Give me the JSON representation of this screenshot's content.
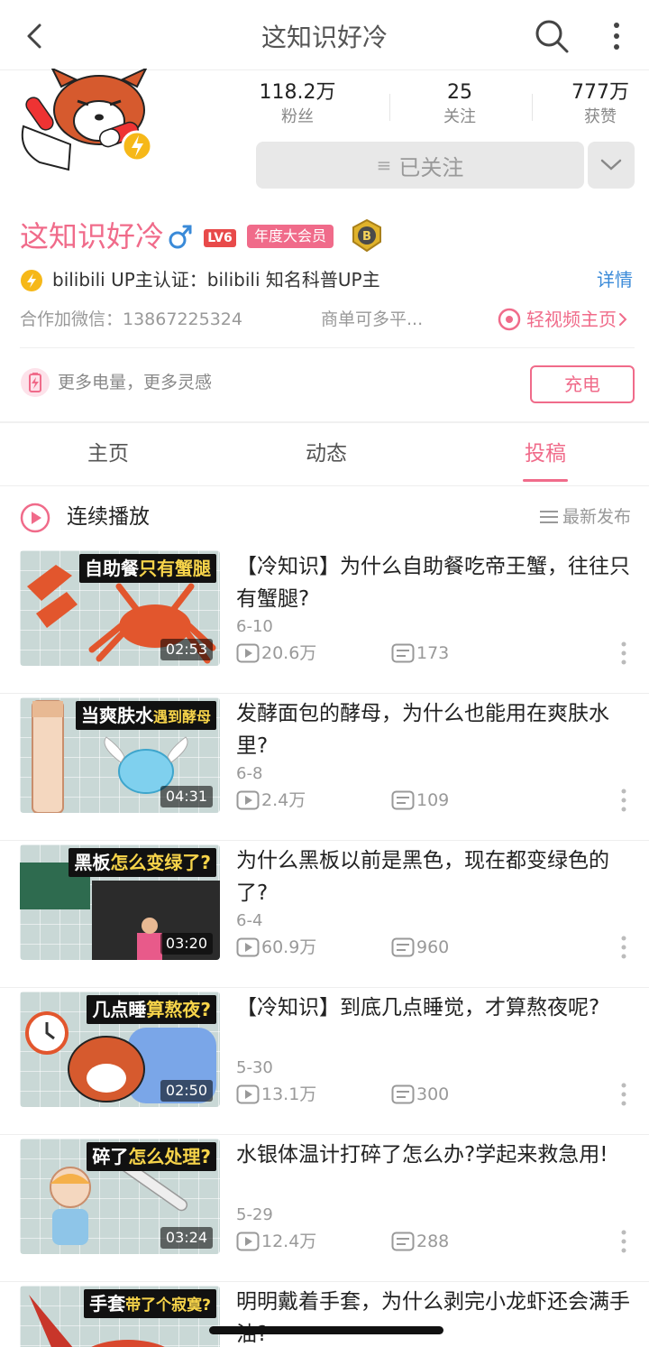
{
  "topbar": {
    "title": "这知识好冷",
    "back_icon": "back-arrow-icon",
    "search_icon": "search-icon",
    "more_icon": "more-vertical-icon"
  },
  "profile": {
    "stats": [
      {
        "value": "118.2万",
        "label": "粉丝"
      },
      {
        "value": "25",
        "label": "关注"
      },
      {
        "value": "777万",
        "label": "获赞"
      }
    ],
    "follow_label": "已关注",
    "username": "这知识好冷",
    "level": "LV6",
    "vip_label": "年度大会员",
    "verify_text": "bilibili  UP主认证：bilibili  知名科普UP主",
    "verify_link": "详情",
    "contact_text": "合作加微信：13867225324",
    "contact_text2": "商单可多平...",
    "light_video_link": "轻视频主页",
    "charge_text": "更多电量，更多灵感",
    "charge_button": "充电"
  },
  "tabs": [
    {
      "label": "主页",
      "active": false
    },
    {
      "label": "动态",
      "active": false
    },
    {
      "label": "投稿",
      "active": true
    }
  ],
  "playbar": {
    "label": "连续播放",
    "sort_label": "最新发布"
  },
  "videos": [
    {
      "tag_white": "自助餐",
      "tag_yellow": "只有蟹腿",
      "duration": "02:53",
      "title": "【冷知识】为什么自助餐吃帝王蟹，往往只有蟹腿?",
      "date": "6-10",
      "views": "20.6万",
      "danmaku": "173"
    },
    {
      "tag_white": "当爽肤水",
      "tag_yellow": "遇到酵母",
      "duration": "04:31",
      "title": "发酵面包的酵母，为什么也能用在爽肤水里?",
      "date": "6-8",
      "views": "2.4万",
      "danmaku": "109"
    },
    {
      "tag_white": "黑板",
      "tag_yellow": "怎么变绿了?",
      "duration": "03:20",
      "title": "为什么黑板以前是黑色，现在都变绿色的了?",
      "date": "6-4",
      "views": "60.9万",
      "danmaku": "960"
    },
    {
      "tag_white": "几点睡",
      "tag_yellow": "算熬夜?",
      "duration": "02:50",
      "title": "【冷知识】到底几点睡觉，才算熬夜呢?",
      "date": "5-30",
      "views": "13.1万",
      "danmaku": "300"
    },
    {
      "tag_white": "碎了",
      "tag_yellow": "怎么处理?",
      "duration": "03:24",
      "title": "水银体温计打碎了怎么办?学起来救急用!",
      "date": "5-29",
      "views": "12.4万",
      "danmaku": "288"
    },
    {
      "tag_white": "手套",
      "tag_yellow": "带了个寂寞?",
      "duration": "",
      "title": "明明戴着手套，为什么剥完小龙虾还会满手油?",
      "date": "",
      "views": "",
      "danmaku": ""
    }
  ],
  "colors": {
    "accent": "#f06b8a",
    "link": "#3a8ad8",
    "muted": "#999999"
  }
}
